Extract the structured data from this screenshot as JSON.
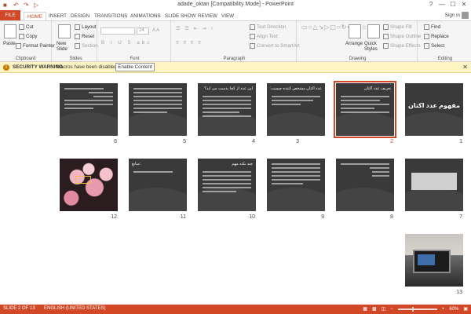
{
  "window": {
    "title": "adade_oktan [Compatibility Mode] - PowerPoint",
    "controls": [
      "?",
      "—",
      "☐",
      "✕"
    ]
  },
  "quick_access": [
    "save-icon",
    "undo-icon",
    "redo-icon",
    "present-icon"
  ],
  "tabs": [
    "FILE",
    "HOME",
    "INSERT",
    "DESIGN",
    "TRANSITIONS",
    "ANIMATIONS",
    "SLIDE SHOW",
    "REVIEW",
    "VIEW"
  ],
  "active_tab": "HOME",
  "signin": "Sign in",
  "ribbon": {
    "clipboard": {
      "label": "Clipboard",
      "paste": "Paste",
      "cut": "Cut",
      "copy": "Copy",
      "format_painter": "Format Painter"
    },
    "slides": {
      "label": "Slides",
      "new_slide": "New Slide",
      "layout": "Layout",
      "reset": "Reset",
      "section": "Section"
    },
    "font": {
      "label": "Font",
      "font_name": "",
      "font_size": "24"
    },
    "paragraph": {
      "label": "Paragraph",
      "text_direction": "Text Direction",
      "align_text": "Align Text",
      "convert": "Convert to SmartArt"
    },
    "drawing": {
      "label": "Drawing",
      "arrange": "Arrange",
      "quick_styles": "Quick Styles",
      "shape_fill": "Shape Fill",
      "shape_outline": "Shape Outline",
      "shape_effects": "Shape Effects"
    },
    "editing": {
      "label": "Editing",
      "find": "Find",
      "replace": "Replace",
      "select": "Select"
    }
  },
  "security": {
    "heading": "SECURITY WARNING",
    "message": "Macros have been disabled.",
    "button": "Enable Content"
  },
  "slides": [
    {
      "num": "1",
      "title": "مفهوم عدد اکتان",
      "kind": "title"
    },
    {
      "num": "2",
      "title": "تعریف عدد اکتان",
      "kind": "text",
      "selected": true
    },
    {
      "num": "3",
      "title": "عدد اکتان مشخص کننده چیست؟",
      "kind": "text"
    },
    {
      "num": "4",
      "title": "این عدد از کجا بدست می آید؟",
      "kind": "text"
    },
    {
      "num": "5",
      "title": "",
      "kind": "text"
    },
    {
      "num": "6",
      "title": "",
      "kind": "text"
    },
    {
      "num": "7",
      "title": "",
      "kind": "table"
    },
    {
      "num": "8",
      "title": "",
      "kind": "text"
    },
    {
      "num": "9",
      "title": "",
      "kind": "text"
    },
    {
      "num": "10",
      "title": "چند نکته مهم",
      "kind": "text"
    },
    {
      "num": "11",
      "title": "منابع:",
      "kind": "text"
    },
    {
      "num": "12",
      "title": "",
      "kind": "roses"
    },
    {
      "num": "13",
      "title": "",
      "kind": "laptop"
    }
  ],
  "status": {
    "slide_info": "SLIDE 2 OF 13",
    "language": "ENGLISH (UNITED STATES)",
    "zoom": "60%"
  }
}
